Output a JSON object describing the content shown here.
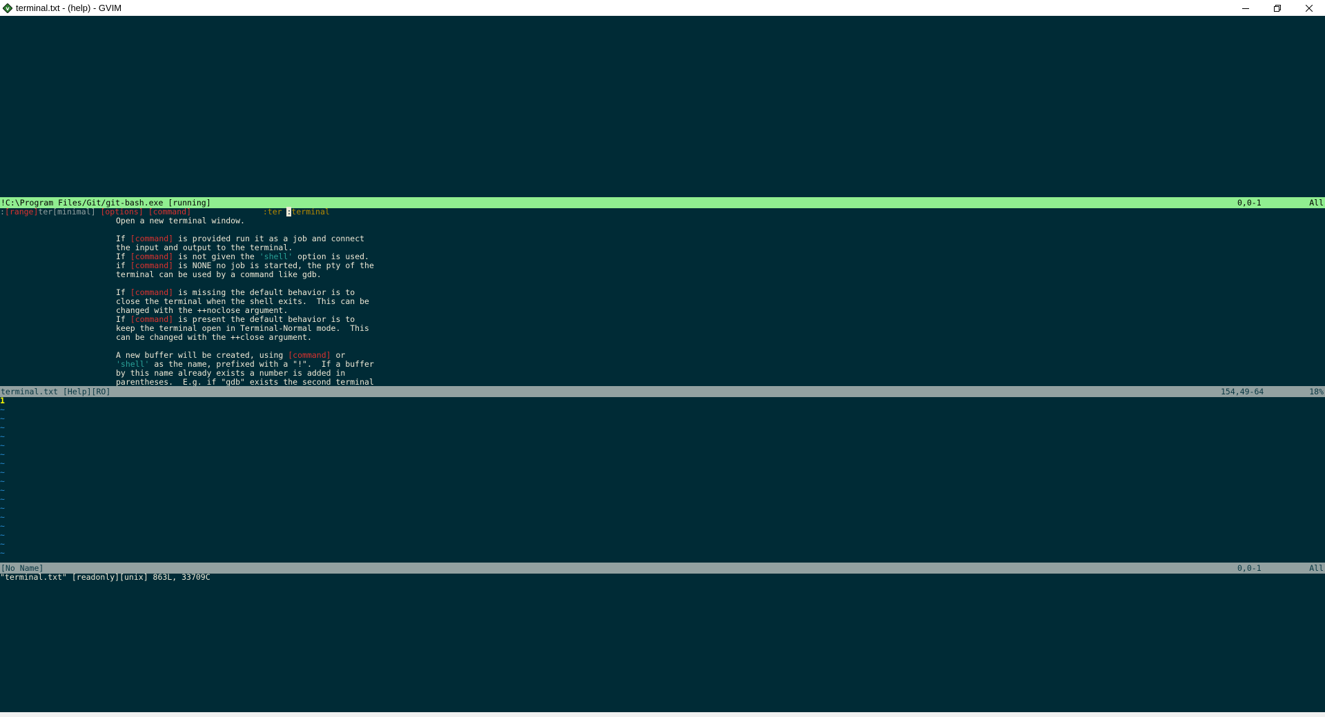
{
  "window": {
    "title": "terminal.txt - (help) - GVIM",
    "controls": {
      "minimize_icon": "minimize-icon",
      "restore_icon": "restore-icon",
      "close_icon": "close-icon"
    }
  },
  "terminal_window": {
    "status": {
      "name": "!C:\\Program Files/Git/git-bash.exe [running]",
      "position": "0,0-1",
      "percent": "All"
    }
  },
  "help_window": {
    "signature": {
      "prefix": ":",
      "range": "[range]",
      "cmd": "ter[minimal]",
      "options": "[options]",
      "command": "[command]",
      "spacer": "               ",
      "tag_prefix": ":ter ",
      "tag_cursor": ":",
      "tag_rest": "terminal"
    },
    "line_open": "Open a new terminal window.",
    "p1_a_pre": "If ",
    "p1_a_cmd": "[command]",
    "p1_a_post": " is provided run it as a job and connect",
    "p1_b": "the input and output to the terminal.",
    "p1_c_pre": "If ",
    "p1_c_cmd": "[command]",
    "p1_c_mid": " is not given the ",
    "p1_c_opt": "'shell'",
    "p1_c_post": " option is used.",
    "p1_d_pre": "if ",
    "p1_d_cmd": "[command]",
    "p1_d_post": " is NONE no job is started, the pty of the",
    "p1_e": "terminal can be used by a command like gdb.",
    "p2_a_pre": "If ",
    "p2_a_cmd": "[command]",
    "p2_a_post": " is missing the default behavior is to",
    "p2_b": "close the terminal when the shell exits.  This can be",
    "p2_c": "changed with the ++noclose argument.",
    "p2_d_pre": "If ",
    "p2_d_cmd": "[command]",
    "p2_d_post": " is present the default behavior is to",
    "p2_e": "keep the terminal open in Terminal-Normal mode.  This",
    "p2_f": "can be changed with the ++close argument.",
    "p3_a_pre": "A new buffer will be created, using ",
    "p3_a_cmd": "[command]",
    "p3_a_post": " or",
    "p3_b_opt": "'shell'",
    "p3_b_post": " as the name, prefixed with a \"!\".  If a buffer",
    "p3_c": "by this name already exists a number is added in",
    "p3_d": "parentheses.  E.g. if \"gdb\" exists the second terminal",
    "status": {
      "name": "terminal.txt [Help][RO]",
      "position": "154,49-64",
      "percent": "18%"
    }
  },
  "noname_window": {
    "first_line": "1",
    "tilde": "~",
    "status": {
      "name": "[No Name]",
      "position": "0,0-1",
      "percent": "All"
    }
  },
  "message_line": "\"terminal.txt\" [readonly][unix] 863L, 33709C"
}
